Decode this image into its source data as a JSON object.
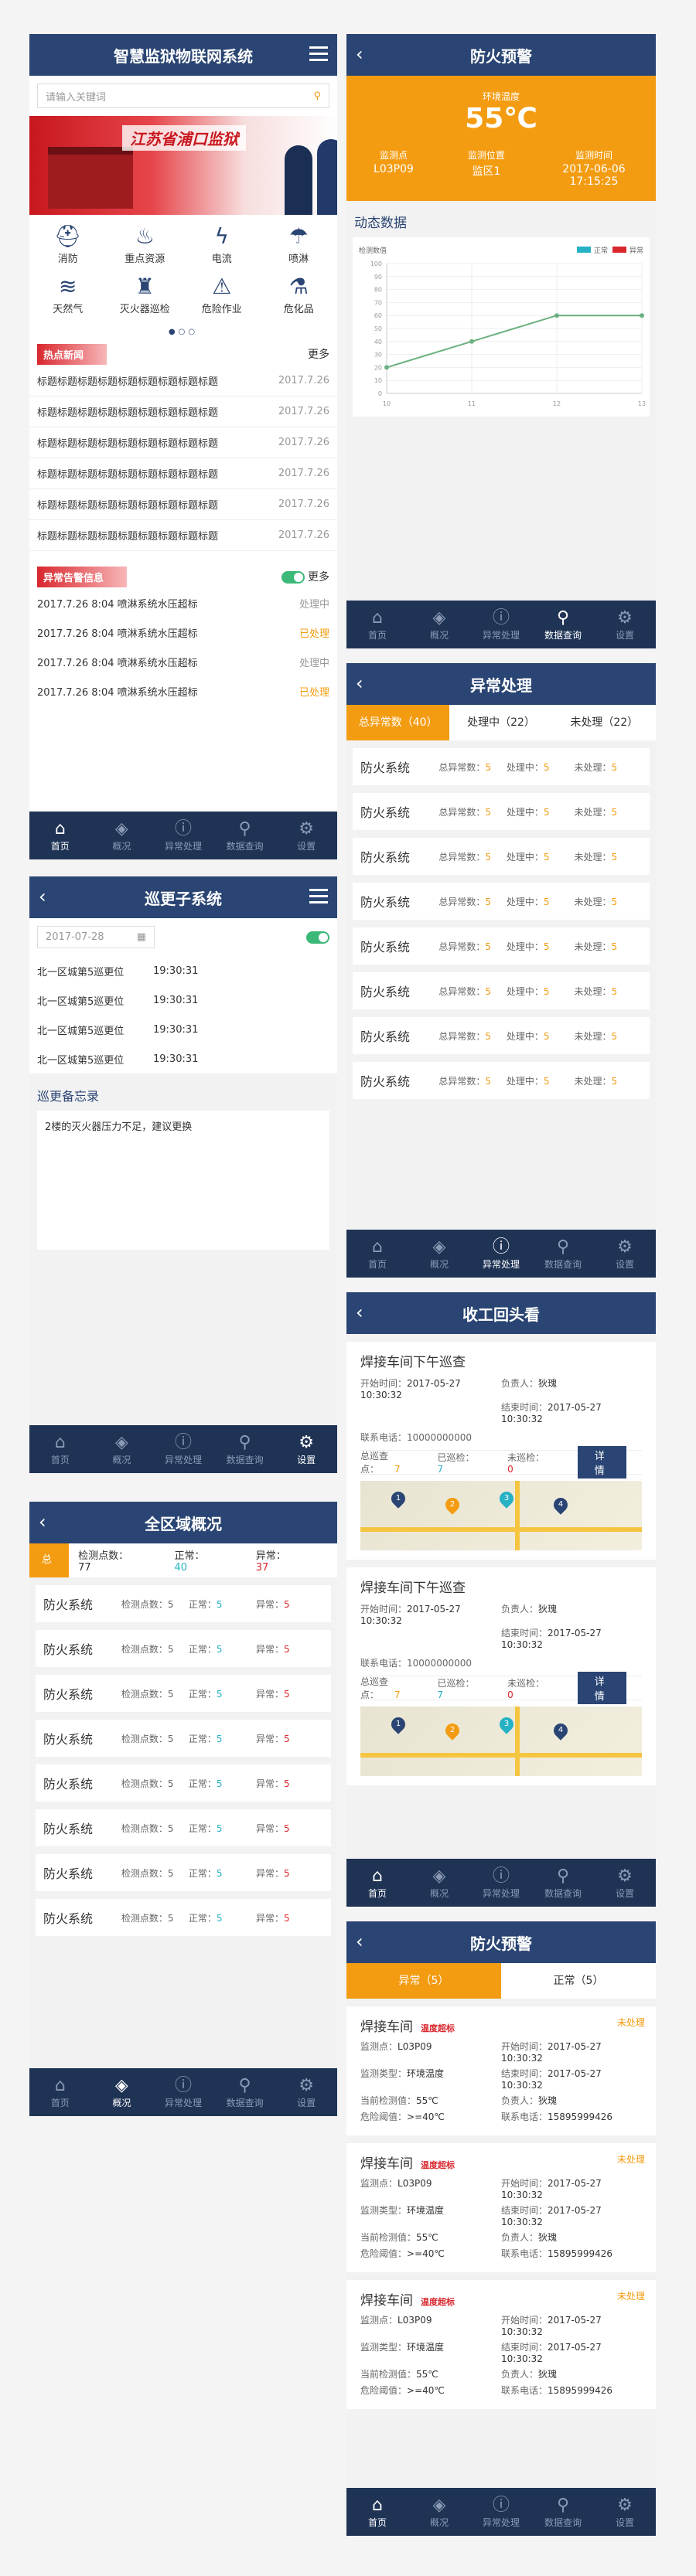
{
  "tab_labels": [
    "首页",
    "概况",
    "异常处理",
    "数据查询",
    "设置"
  ],
  "screen1": {
    "title": "智慧监狱物联网系统",
    "search_placeholder": "请输入关键词",
    "banner_text": "江苏省浦口监狱",
    "grid": [
      {
        "label": "消防",
        "icon": "hydrant-icon",
        "glyph": "⛑"
      },
      {
        "label": "重点资源",
        "icon": "flame-icon",
        "glyph": "♨"
      },
      {
        "label": "电流",
        "icon": "lightning-icon",
        "glyph": "ϟ"
      },
      {
        "label": "喷淋",
        "icon": "shower-icon",
        "glyph": "☂"
      },
      {
        "label": "天然气",
        "icon": "gas-icon",
        "glyph": "≋"
      },
      {
        "label": "灭火器巡检",
        "icon": "extinguisher-icon",
        "glyph": "♜"
      },
      {
        "label": "危险作业",
        "icon": "warning-icon",
        "glyph": "⚠"
      },
      {
        "label": "危化品",
        "icon": "flask-icon",
        "glyph": "⚗"
      }
    ],
    "news_title": "热点新闻",
    "news_more": "更多",
    "news": [
      {
        "text": "标题标题标题标题标题标题标题标题标题",
        "date": "2017.7.26"
      },
      {
        "text": "标题标题标题标题标题标题标题标题标题",
        "date": "2017.7.26"
      },
      {
        "text": "标题标题标题标题标题标题标题标题标题",
        "date": "2017.7.26"
      },
      {
        "text": "标题标题标题标题标题标题标题标题标题",
        "date": "2017.7.26"
      },
      {
        "text": "标题标题标题标题标题标题标题标题标题",
        "date": "2017.7.26"
      },
      {
        "text": "标题标题标题标题标题标题标题标题标题",
        "date": "2017.7.26"
      }
    ],
    "alarm_title": "异常告警信息",
    "alarm_more": "更多",
    "alarms": [
      {
        "text": "2017.7.26 8:04 喷淋系统水压超标",
        "status": "处理中",
        "done": false
      },
      {
        "text": "2017.7.26 8:04 喷淋系统水压超标",
        "status": "已处理",
        "done": true
      },
      {
        "text": "2017.7.26 8:04 喷淋系统水压超标",
        "status": "处理中",
        "done": false
      },
      {
        "text": "2017.7.26 8:04 喷淋系统水压超标",
        "status": "已处理",
        "done": true
      }
    ]
  },
  "screen2": {
    "title": "巡更子系统",
    "date": "2017-07-28",
    "rows": [
      {
        "place": "北一区城第5巡更位",
        "time": "19:30:31"
      },
      {
        "place": "北一区城第5巡更位",
        "time": "19:30:31"
      },
      {
        "place": "北一区城第5巡更位",
        "time": "19:30:31"
      },
      {
        "place": "北一区城第5巡更位",
        "time": "19:30:31"
      }
    ],
    "memo_title": "巡更备忘录",
    "memo_text": "2楼的灭火器压力不足，建议更换"
  },
  "screen3": {
    "title": "全区域概况",
    "total_label": "总计",
    "points_label": "检测点数：",
    "points": "77",
    "normal_label": "正常：",
    "normal": "40",
    "abnormal_label": "异常：",
    "abnormal": "37",
    "field_points": "检测点数：",
    "field_normal": "正常：",
    "field_abnormal": "异常：",
    "cards": [
      {
        "name": "防火系统",
        "points": "5",
        "normal": "5",
        "abnormal": "5"
      },
      {
        "name": "防火系统",
        "points": "5",
        "normal": "5",
        "abnormal": "5"
      },
      {
        "name": "防火系统",
        "points": "5",
        "normal": "5",
        "abnormal": "5"
      },
      {
        "name": "防火系统",
        "points": "5",
        "normal": "5",
        "abnormal": "5"
      },
      {
        "name": "防火系统",
        "points": "5",
        "normal": "5",
        "abnormal": "5"
      },
      {
        "name": "防火系统",
        "points": "5",
        "normal": "5",
        "abnormal": "5"
      },
      {
        "name": "防火系统",
        "points": "5",
        "normal": "5",
        "abnormal": "5"
      },
      {
        "name": "防火系统",
        "points": "5",
        "normal": "5",
        "abnormal": "5"
      }
    ]
  },
  "screen4": {
    "title": "防火预警",
    "temp_label": "环境温度",
    "temp": "55℃",
    "point_label": "监测点",
    "point": "L03P09",
    "area_label": "监测位置",
    "area": "监区1",
    "time_label": "监测时间",
    "time": "2017-06-06 17:15:25",
    "dyn_title": "动态数据"
  },
  "chart_data": {
    "type": "line",
    "ylabel": "检测数值",
    "legend": [
      "正常",
      "异常"
    ],
    "legend_colors": [
      "#27b1c4",
      "#d9272e"
    ],
    "x": [
      "10",
      "11",
      "12",
      "13"
    ],
    "y_ticks": [
      "100",
      "90",
      "80",
      "70",
      "60",
      "50",
      "40",
      "30",
      "20",
      "10",
      "0"
    ],
    "ylim": [
      0,
      100
    ],
    "series": [
      {
        "name": "正常",
        "x": [
          10,
          11,
          12,
          13
        ],
        "values": [
          20,
          40,
          60,
          60
        ]
      }
    ]
  },
  "screen5": {
    "title": "异常处理",
    "tabs": [
      {
        "label": "总异常数（40）"
      },
      {
        "label": "处理中（22）"
      },
      {
        "label": "未处理（22）"
      }
    ],
    "field_total": "总异常数：",
    "field_doing": "处理中：",
    "field_todo": "未处理：",
    "rows": [
      {
        "name": "防火系统",
        "total": "5",
        "doing": "5",
        "todo": "5"
      },
      {
        "name": "防火系统",
        "total": "5",
        "doing": "5",
        "todo": "5"
      },
      {
        "name": "防火系统",
        "total": "5",
        "doing": "5",
        "todo": "5"
      },
      {
        "name": "防火系统",
        "total": "5",
        "doing": "5",
        "todo": "5"
      },
      {
        "name": "防火系统",
        "total": "5",
        "doing": "5",
        "todo": "5"
      },
      {
        "name": "防火系统",
        "total": "5",
        "doing": "5",
        "todo": "5"
      },
      {
        "name": "防火系统",
        "total": "5",
        "doing": "5",
        "todo": "5"
      },
      {
        "name": "防火系统",
        "total": "5",
        "doing": "5",
        "todo": "5"
      }
    ]
  },
  "screen6": {
    "title": "收工回头看",
    "items": [
      {
        "name": "焊接车间下午巡查",
        "start_label": "开始时间：",
        "start": "2017-05-27 10:30:32",
        "lead_label": "负责人：",
        "lead": "狄瑰",
        "end_label": "结束时间：",
        "end": "2017-05-27 10:30:32",
        "phone_label": "联系电话：",
        "phone": "10000000000",
        "total_label": "总巡查点：",
        "total": "7",
        "done_label": "已巡检：",
        "done": "7",
        "undone_label": "未巡检：",
        "undone": "0",
        "detail": "详情",
        "pins": [
          "1",
          "2",
          "3",
          "4"
        ]
      },
      {
        "name": "焊接车间下午巡查",
        "start_label": "开始时间：",
        "start": "2017-05-27 10:30:32",
        "lead_label": "负责人：",
        "lead": "狄瑰",
        "end_label": "结束时间：",
        "end": "2017-05-27 10:30:32",
        "phone_label": "联系电话：",
        "phone": "10000000000",
        "total_label": "总巡查点：",
        "total": "7",
        "done_label": "已巡检：",
        "done": "7",
        "undone_label": "未巡检：",
        "undone": "0",
        "detail": "详情",
        "pins": [
          "1",
          "2",
          "3",
          "4"
        ]
      }
    ]
  },
  "screen7": {
    "title": "防火预警",
    "tabs": [
      {
        "label": "异常（5）"
      },
      {
        "label": "正常（5）"
      }
    ],
    "items": [
      {
        "name": "焊接车间",
        "tag": "温度超标",
        "status": "未处理",
        "point_label": "监测点：",
        "point": "L03P09",
        "start_label": "开始时间：",
        "start": "2017-05-27 10:30:32",
        "type_label": "监测类型：",
        "type": "环境温度",
        "end_label": "结束时间：",
        "end": "2017-05-27 10:30:32",
        "cur_label": "当前检测值：",
        "cur": "55℃",
        "lead_label": "负责人：",
        "lead": "狄瑰",
        "thr_label": "危险阈值：",
        "thr": ">=40℃",
        "phone_label": "联系电话：",
        "phone": "15895999426"
      },
      {
        "name": "焊接车间",
        "tag": "温度超标",
        "status": "未处理",
        "point_label": "监测点：",
        "point": "L03P09",
        "start_label": "开始时间：",
        "start": "2017-05-27 10:30:32",
        "type_label": "监测类型：",
        "type": "环境温度",
        "end_label": "结束时间：",
        "end": "2017-05-27 10:30:32",
        "cur_label": "当前检测值：",
        "cur": "55℃",
        "lead_label": "负责人：",
        "lead": "狄瑰",
        "thr_label": "危险阈值：",
        "thr": ">=40℃",
        "phone_label": "联系电话：",
        "phone": "15895999426"
      },
      {
        "name": "焊接车间",
        "tag": "温度超标",
        "status": "未处理",
        "point_label": "监测点：",
        "point": "L03P09",
        "start_label": "开始时间：",
        "start": "2017-05-27 10:30:32",
        "type_label": "监测类型：",
        "type": "环境温度",
        "end_label": "结束时间：",
        "end": "2017-05-27 10:30:32",
        "cur_label": "当前检测值：",
        "cur": "55℃",
        "lead_label": "负责人：",
        "lead": "狄瑰",
        "thr_label": "危险阈值：",
        "thr": ">=40℃",
        "phone_label": "联系电话：",
        "phone": "15895999426"
      }
    ]
  }
}
